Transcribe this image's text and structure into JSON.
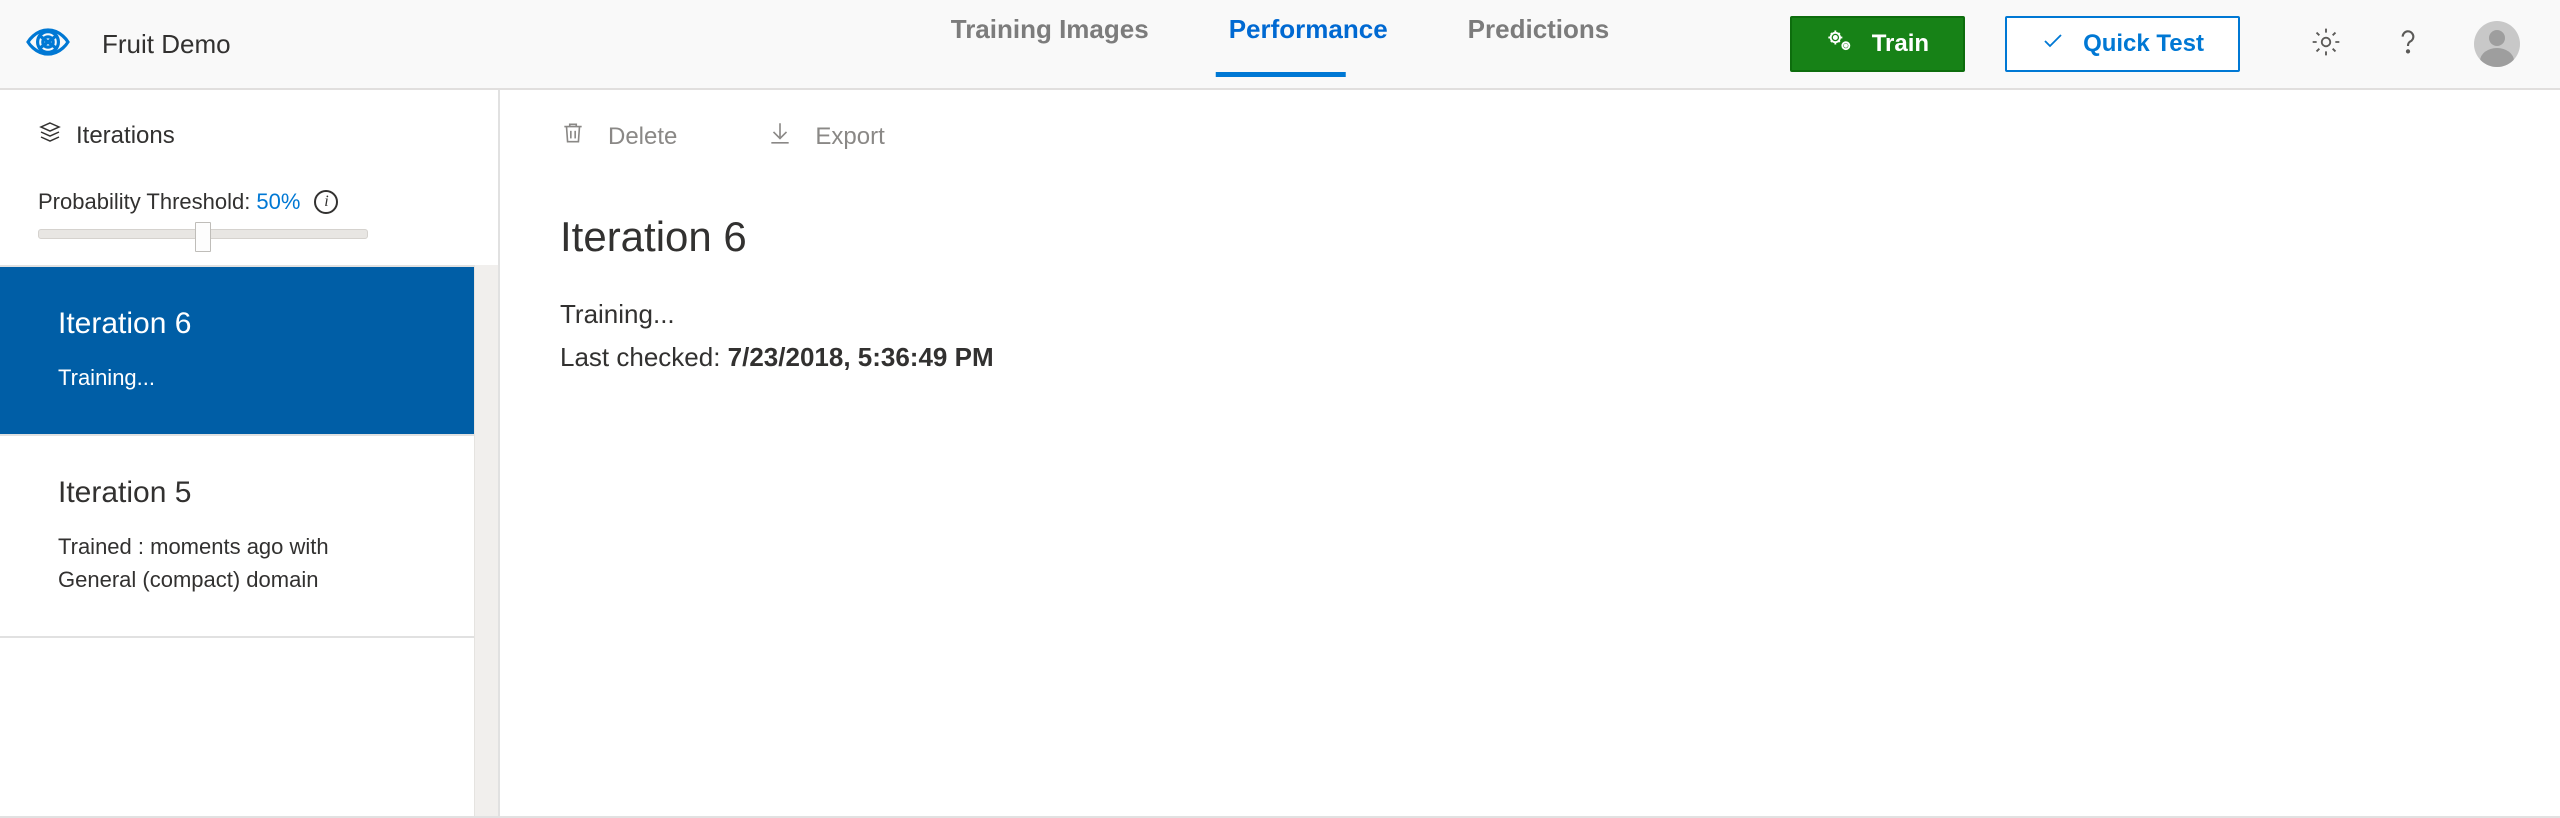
{
  "header": {
    "project_name": "Fruit Demo",
    "tabs": [
      {
        "label": "Training Images",
        "active": false
      },
      {
        "label": "Performance",
        "active": true
      },
      {
        "label": "Predictions",
        "active": false
      }
    ],
    "train_label": "Train",
    "quicktest_label": "Quick Test"
  },
  "sidebar": {
    "title": "Iterations",
    "threshold_label": "Probability Threshold:",
    "threshold_value": "50%",
    "items": [
      {
        "title": "Iteration 6",
        "subtitle": "Training...",
        "selected": true
      },
      {
        "title": "Iteration 5",
        "subtitle": "Trained : moments ago with General (compact) domain",
        "selected": false
      }
    ]
  },
  "content": {
    "actions": {
      "delete": "Delete",
      "export": "Export"
    },
    "iteration_title": "Iteration 6",
    "status": "Training...",
    "last_checked_label": "Last checked: ",
    "last_checked_value": "7/23/2018, 5:36:49 PM"
  }
}
